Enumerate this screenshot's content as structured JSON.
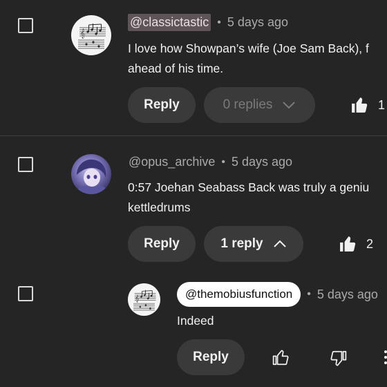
{
  "comments": [
    {
      "author": "@classictastic",
      "time": "5 days ago",
      "text_lines": [
        "I love how Showpan’s wife (Joe Sam Back), f",
        "ahead of his time."
      ],
      "reply_label": "Reply",
      "replies_label": "0 replies",
      "like_count": "1"
    },
    {
      "author": "@opus_archive",
      "time": "5 days ago",
      "text_lines": [
        "0:57 Joehan Seabass Back was truly a geniu",
        "kettledrums"
      ],
      "reply_label": "Reply",
      "replies_label": "1 reply",
      "like_count": "2"
    }
  ],
  "reply": {
    "author": "@themobiusfunction",
    "time": "5 days ago",
    "text": "Indeed",
    "reply_label": "Reply"
  },
  "separator": "•",
  "colors": {
    "background": "#252525",
    "pill": "#3a3a3a",
    "muted_text": "#aaaaaa",
    "highlight": "#5f5558"
  }
}
